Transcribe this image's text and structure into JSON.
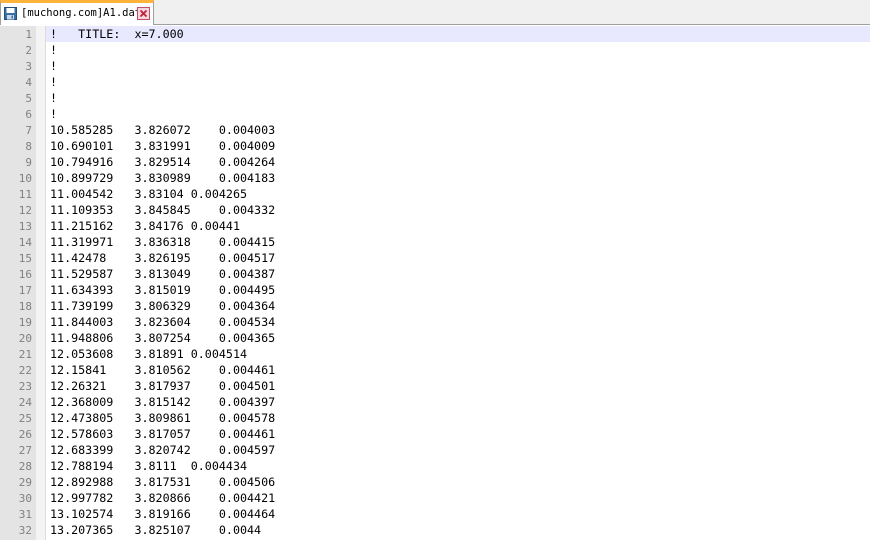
{
  "tab": {
    "title": "[muchong.com]A1.dat",
    "icon": "save-icon",
    "close_icon": "close-icon",
    "accent": "#ffb33a"
  },
  "editor": {
    "current_line_color": "#e8e8ff",
    "lines": [
      {
        "number": "1",
        "text": "!   TITLE:  x=7.000"
      },
      {
        "number": "2",
        "text": "!"
      },
      {
        "number": "3",
        "text": "!"
      },
      {
        "number": "4",
        "text": "!"
      },
      {
        "number": "5",
        "text": "!"
      },
      {
        "number": "6",
        "text": "!"
      },
      {
        "number": "7",
        "text": "10.585285   3.826072    0.004003"
      },
      {
        "number": "8",
        "text": "10.690101   3.831991    0.004009"
      },
      {
        "number": "9",
        "text": "10.794916   3.829514    0.004264"
      },
      {
        "number": "10",
        "text": "10.899729   3.830989    0.004183"
      },
      {
        "number": "11",
        "text": "11.004542   3.83104 0.004265"
      },
      {
        "number": "12",
        "text": "11.109353   3.845845    0.004332"
      },
      {
        "number": "13",
        "text": "11.215162   3.84176 0.00441"
      },
      {
        "number": "14",
        "text": "11.319971   3.836318    0.004415"
      },
      {
        "number": "15",
        "text": "11.42478    3.826195    0.004517"
      },
      {
        "number": "16",
        "text": "11.529587   3.813049    0.004387"
      },
      {
        "number": "17",
        "text": "11.634393   3.815019    0.004495"
      },
      {
        "number": "18",
        "text": "11.739199   3.806329    0.004364"
      },
      {
        "number": "19",
        "text": "11.844003   3.823604    0.004534"
      },
      {
        "number": "20",
        "text": "11.948806   3.807254    0.004365"
      },
      {
        "number": "21",
        "text": "12.053608   3.81891 0.004514"
      },
      {
        "number": "22",
        "text": "12.15841    3.810562    0.004461"
      },
      {
        "number": "23",
        "text": "12.26321    3.817937    0.004501"
      },
      {
        "number": "24",
        "text": "12.368009   3.815142    0.004397"
      },
      {
        "number": "25",
        "text": "12.473805   3.809861    0.004578"
      },
      {
        "number": "26",
        "text": "12.578603   3.817057    0.004461"
      },
      {
        "number": "27",
        "text": "12.683399   3.820742    0.004597"
      },
      {
        "number": "28",
        "text": "12.788194   3.8111  0.004434"
      },
      {
        "number": "29",
        "text": "12.892988   3.817531    0.004506"
      },
      {
        "number": "30",
        "text": "12.997782   3.820866    0.004421"
      },
      {
        "number": "31",
        "text": "13.102574   3.819166    0.004464"
      },
      {
        "number": "32",
        "text": "13.207365   3.825107    0.0044"
      }
    ]
  }
}
